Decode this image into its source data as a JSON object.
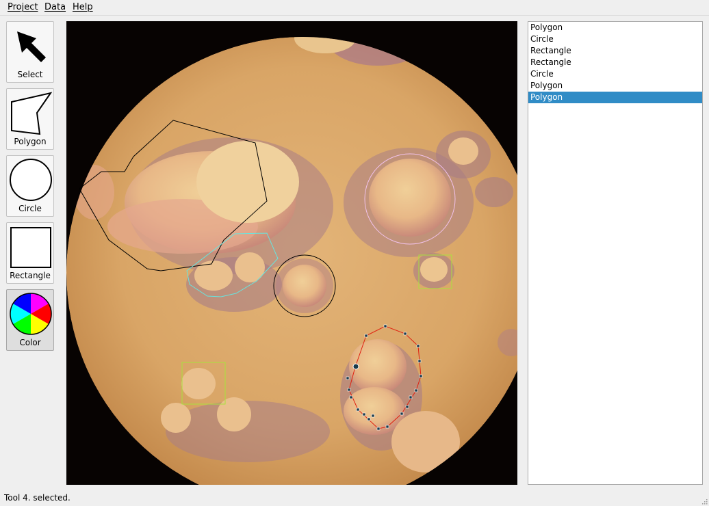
{
  "menu": {
    "project": "Project",
    "data": "Data",
    "help": "Help"
  },
  "tools": {
    "select": "Select",
    "polygon": "Polygon",
    "circle": "Circle",
    "rectangle": "Rectangle",
    "color": "Color",
    "active_tool": "color"
  },
  "shapes_list": [
    {
      "label": "Polygon",
      "selected": false
    },
    {
      "label": "Circle",
      "selected": false
    },
    {
      "label": "Rectangle",
      "selected": false
    },
    {
      "label": "Rectangle",
      "selected": false
    },
    {
      "label": "Circle",
      "selected": false
    },
    {
      "label": "Polygon",
      "selected": false
    },
    {
      "label": "Polygon",
      "selected": true
    }
  ],
  "annotation_colors": {
    "polygon_1": "#000000",
    "circle_1": "#f2c2ec",
    "rectangle_1": "#a8e23c",
    "rectangle_2": "#a8e23c",
    "circle_2": "#000000",
    "polygon_2": "#66e6e0",
    "polygon_3": "#e02010"
  },
  "selection_color": "#308cc6",
  "status": {
    "text": "Tool 4. selected."
  }
}
